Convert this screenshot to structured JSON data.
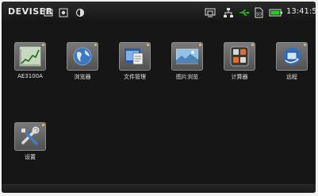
{
  "status_bar": {
    "brand": "DEVISER",
    "time": "13:41:50",
    "icons": [
      "keyboard-icon",
      "screenshot-icon",
      "contrast-icon",
      "display-icon",
      "network-icon",
      "usb-icon",
      "sd-card-icon",
      "battery-icon"
    ]
  },
  "apps": [
    {
      "label": "AE3100A",
      "icon": "analyzer-icon"
    },
    {
      "label": "浏览器",
      "icon": "globe-icon"
    },
    {
      "label": "文件管理",
      "icon": "file-manager-icon"
    },
    {
      "label": "图片浏览",
      "icon": "image-viewer-icon"
    },
    {
      "label": "计算器",
      "icon": "calculator-icon"
    },
    {
      "label": "远程",
      "icon": "remote-icon"
    },
    {
      "label": "设置",
      "icon": "settings-icon"
    }
  ],
  "colors": {
    "accent": "#3ab0ff",
    "battery": "#22cc22"
  }
}
